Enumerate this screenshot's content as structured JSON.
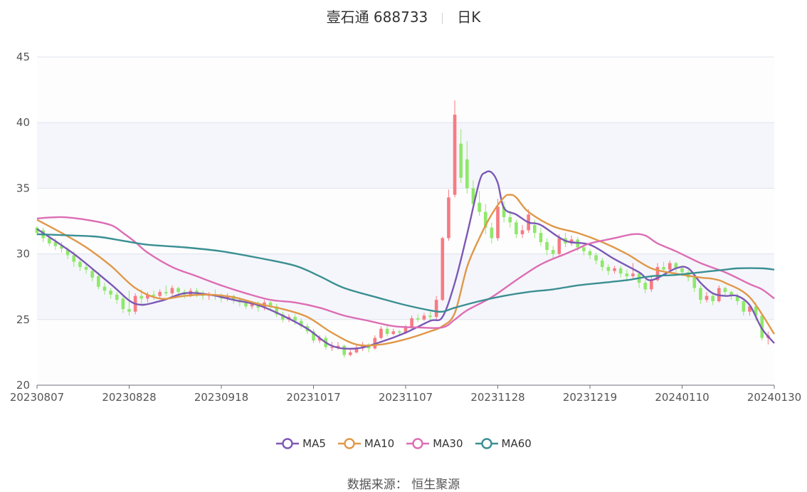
{
  "header": {
    "stock": "壹石通 688733",
    "period": "日K"
  },
  "source": "数据来源：  恒生聚源",
  "colors": {
    "up": "#f77b82",
    "down": "#8ee86a",
    "MA5": "#7c58b5",
    "MA10": "#e09848",
    "MA30": "#dd6db4",
    "MA60": "#3a8f92",
    "grid": "#dfe3ee",
    "band": "#f5f6fb"
  },
  "chart_data": {
    "type": "candlestick",
    "ylim": [
      20,
      45
    ],
    "yticks": [
      "20",
      "25",
      "30",
      "35",
      "40",
      "45"
    ],
    "xticks": [
      "20230807",
      "20230828",
      "20230918",
      "20231017",
      "20231107",
      "20231128",
      "20231219",
      "20240110",
      "20240130"
    ],
    "tick_index": [
      0,
      15,
      30,
      45,
      60,
      75,
      90,
      105,
      120
    ],
    "n_points": 121,
    "candles": [
      [
        32.0,
        31.6,
        32.1,
        31.4
      ],
      [
        31.8,
        31.2,
        32.0,
        30.9
      ],
      [
        31.2,
        30.8,
        31.4,
        30.6
      ],
      [
        30.9,
        30.6,
        31.2,
        30.3
      ],
      [
        30.6,
        30.4,
        30.9,
        30.1
      ],
      [
        30.3,
        29.9,
        30.5,
        29.6
      ],
      [
        29.9,
        29.4,
        30.2,
        29.0
      ],
      [
        29.4,
        29.0,
        29.7,
        28.7
      ],
      [
        29.0,
        28.8,
        29.3,
        28.5
      ],
      [
        28.7,
        28.2,
        28.9,
        27.9
      ],
      [
        28.3,
        27.5,
        28.6,
        27.3
      ],
      [
        27.5,
        27.2,
        27.8,
        26.9
      ],
      [
        27.2,
        26.9,
        27.4,
        26.6
      ],
      [
        26.9,
        26.5,
        27.1,
        26.2
      ],
      [
        26.6,
        25.8,
        26.9,
        25.5
      ],
      [
        25.8,
        25.6,
        27.2,
        25.3
      ],
      [
        25.6,
        26.8,
        27.0,
        25.4
      ],
      [
        26.8,
        26.6,
        27.3,
        26.2
      ],
      [
        26.6,
        26.9,
        27.1,
        26.3
      ],
      [
        26.9,
        26.8,
        27.2,
        26.5
      ],
      [
        26.8,
        27.1,
        27.3,
        26.6
      ],
      [
        27.1,
        27.0,
        27.6,
        26.8
      ],
      [
        27.0,
        27.4,
        27.6,
        26.8
      ],
      [
        27.4,
        27.1,
        27.5,
        26.8
      ],
      [
        27.1,
        26.9,
        27.3,
        26.6
      ],
      [
        26.9,
        27.2,
        27.4,
        26.7
      ],
      [
        27.2,
        27.0,
        27.4,
        26.7
      ],
      [
        27.0,
        26.8,
        27.2,
        26.5
      ],
      [
        26.8,
        26.9,
        27.1,
        26.5
      ],
      [
        26.9,
        26.8,
        27.3,
        26.5
      ],
      [
        26.8,
        26.6,
        27.0,
        26.3
      ],
      [
        26.6,
        26.8,
        27.0,
        26.4
      ],
      [
        26.8,
        26.5,
        26.9,
        26.2
      ],
      [
        26.5,
        26.3,
        26.7,
        26.0
      ],
      [
        26.3,
        26.0,
        26.5,
        25.8
      ],
      [
        26.0,
        26.2,
        26.4,
        25.8
      ],
      [
        26.2,
        25.9,
        26.4,
        25.6
      ],
      [
        25.9,
        26.3,
        26.5,
        25.7
      ],
      [
        26.3,
        26.0,
        26.4,
        25.7
      ],
      [
        26.0,
        25.4,
        26.2,
        25.2
      ],
      [
        25.4,
        25.0,
        25.6,
        24.8
      ],
      [
        25.0,
        25.2,
        25.4,
        24.8
      ],
      [
        25.2,
        24.9,
        25.4,
        24.6
      ],
      [
        24.9,
        24.5,
        25.1,
        24.3
      ],
      [
        24.5,
        24.1,
        24.7,
        23.9
      ],
      [
        24.1,
        23.4,
        24.3,
        23.2
      ],
      [
        23.4,
        23.6,
        23.8,
        23.2
      ],
      [
        23.6,
        22.9,
        23.8,
        22.7
      ],
      [
        22.9,
        22.9,
        23.3,
        22.6
      ],
      [
        22.9,
        23.0,
        23.3,
        22.7
      ],
      [
        23.0,
        22.3,
        23.1,
        22.1
      ],
      [
        22.3,
        22.5,
        22.8,
        22.2
      ],
      [
        22.5,
        22.8,
        23.1,
        22.4
      ],
      [
        22.8,
        23.1,
        23.3,
        22.6
      ],
      [
        23.1,
        22.8,
        23.2,
        22.5
      ],
      [
        22.8,
        23.6,
        23.8,
        22.7
      ],
      [
        23.6,
        24.3,
        24.5,
        23.5
      ],
      [
        24.3,
        23.9,
        24.5,
        23.7
      ],
      [
        23.9,
        24.1,
        24.3,
        23.8
      ],
      [
        24.1,
        24.0,
        24.2,
        23.8
      ],
      [
        24.0,
        24.4,
        24.6,
        23.9
      ],
      [
        24.4,
        25.1,
        25.3,
        24.2
      ],
      [
        25.1,
        25.0,
        25.4,
        24.8
      ],
      [
        25.0,
        25.3,
        25.5,
        24.9
      ],
      [
        25.3,
        25.2,
        25.6,
        24.9
      ],
      [
        25.2,
        26.5,
        26.8,
        25.0
      ],
      [
        26.5,
        31.2,
        31.3,
        26.4
      ],
      [
        31.2,
        34.3,
        34.9,
        31.0
      ],
      [
        34.5,
        40.6,
        41.7,
        34.3
      ],
      [
        38.4,
        35.8,
        39.5,
        35.4
      ],
      [
        37.2,
        35.0,
        38.6,
        34.6
      ],
      [
        35.0,
        33.8,
        35.6,
        33.4
      ],
      [
        33.9,
        33.2,
        34.8,
        32.9
      ],
      [
        33.2,
        32.0,
        33.8,
        31.5
      ],
      [
        32.0,
        31.2,
        32.4,
        30.8
      ],
      [
        31.2,
        33.6,
        34.2,
        31.0
      ],
      [
        33.6,
        32.8,
        34.0,
        32.4
      ],
      [
        32.8,
        32.4,
        33.3,
        32.0
      ],
      [
        32.4,
        31.5,
        32.6,
        31.2
      ],
      [
        31.5,
        31.8,
        32.2,
        31.2
      ],
      [
        31.8,
        33.0,
        33.4,
        31.6
      ],
      [
        32.2,
        31.6,
        32.6,
        31.2
      ],
      [
        31.6,
        30.9,
        32.0,
        30.6
      ],
      [
        30.9,
        30.3,
        31.2,
        29.9
      ],
      [
        30.3,
        30.0,
        30.6,
        29.6
      ],
      [
        30.0,
        31.2,
        31.5,
        29.9
      ],
      [
        31.2,
        30.8,
        31.6,
        30.5
      ],
      [
        30.8,
        31.1,
        31.4,
        30.6
      ],
      [
        31.1,
        30.5,
        31.3,
        30.2
      ],
      [
        30.5,
        30.2,
        30.8,
        29.9
      ],
      [
        30.2,
        29.9,
        30.4,
        29.6
      ],
      [
        29.9,
        29.5,
        30.1,
        29.2
      ],
      [
        29.5,
        29.0,
        29.7,
        28.7
      ],
      [
        29.0,
        28.7,
        29.2,
        28.4
      ],
      [
        28.7,
        28.9,
        29.1,
        28.5
      ],
      [
        28.9,
        28.5,
        29.1,
        28.2
      ],
      [
        28.5,
        28.3,
        28.8,
        27.9
      ],
      [
        28.3,
        28.5,
        29.3,
        28.1
      ],
      [
        28.5,
        27.8,
        28.7,
        27.4
      ],
      [
        27.8,
        27.3,
        28.0,
        27.0
      ],
      [
        27.3,
        28.0,
        28.3,
        27.1
      ],
      [
        28.0,
        29.0,
        29.3,
        27.9
      ],
      [
        29.0,
        28.8,
        29.4,
        28.6
      ],
      [
        28.8,
        29.3,
        29.5,
        28.7
      ],
      [
        29.3,
        28.9,
        29.4,
        28.6
      ],
      [
        28.9,
        28.6,
        29.1,
        28.3
      ],
      [
        28.6,
        28.2,
        28.8,
        27.9
      ],
      [
        28.2,
        27.4,
        28.4,
        27.1
      ],
      [
        27.4,
        26.5,
        27.6,
        26.2
      ],
      [
        26.5,
        26.8,
        27.1,
        26.3
      ],
      [
        26.8,
        26.4,
        27.0,
        26.1
      ],
      [
        26.4,
        27.4,
        27.6,
        26.3
      ],
      [
        27.4,
        27.1,
        27.5,
        26.8
      ],
      [
        27.1,
        26.8,
        27.2,
        26.5
      ],
      [
        26.8,
        26.4,
        27.0,
        26.1
      ],
      [
        26.4,
        25.6,
        26.6,
        25.3
      ],
      [
        25.6,
        26.0,
        26.2,
        25.3
      ],
      [
        26.0,
        25.3,
        26.3,
        24.9
      ],
      [
        25.3,
        23.6,
        25.4,
        23.4
      ],
      [
        23.6,
        23.8,
        24.1,
        23.1
      ]
    ],
    "series": [
      {
        "name": "MA5",
        "color": "#7c58b5",
        "points": [
          [
            0,
            31.9
          ],
          [
            6,
            30.0
          ],
          [
            12,
            27.7
          ],
          [
            16,
            26.2
          ],
          [
            20,
            26.4
          ],
          [
            24,
            27.0
          ],
          [
            28,
            26.9
          ],
          [
            32,
            26.5
          ],
          [
            36,
            26.1
          ],
          [
            40,
            25.3
          ],
          [
            44,
            24.3
          ],
          [
            48,
            23.0
          ],
          [
            52,
            22.8
          ],
          [
            56,
            23.3
          ],
          [
            60,
            24.0
          ],
          [
            64,
            24.9
          ],
          [
            66,
            25.2
          ],
          [
            68,
            27.8
          ],
          [
            70,
            31.5
          ],
          [
            72,
            35.5
          ],
          [
            73,
            36.2
          ],
          [
            74,
            36.2
          ],
          [
            75,
            35.4
          ],
          [
            76,
            33.5
          ],
          [
            78,
            33.0
          ],
          [
            80,
            32.4
          ],
          [
            82,
            32.2
          ],
          [
            86,
            31.0
          ],
          [
            90,
            30.7
          ],
          [
            94,
            29.6
          ],
          [
            98,
            28.6
          ],
          [
            100,
            28.0
          ],
          [
            104,
            28.9
          ],
          [
            106,
            28.9
          ],
          [
            108,
            27.8
          ],
          [
            110,
            27.0
          ],
          [
            112,
            26.8
          ],
          [
            114,
            26.8
          ],
          [
            116,
            26.1
          ],
          [
            118,
            24.3
          ],
          [
            120,
            23.2
          ]
        ]
      },
      {
        "name": "MA10",
        "color": "#e09848",
        "points": [
          [
            0,
            32.6
          ],
          [
            4,
            31.6
          ],
          [
            8,
            30.5
          ],
          [
            12,
            29.1
          ],
          [
            16,
            27.4
          ],
          [
            20,
            26.6
          ],
          [
            24,
            26.8
          ],
          [
            28,
            26.9
          ],
          [
            32,
            26.7
          ],
          [
            36,
            26.2
          ],
          [
            40,
            25.8
          ],
          [
            44,
            25.2
          ],
          [
            48,
            24.0
          ],
          [
            52,
            23.1
          ],
          [
            56,
            23.1
          ],
          [
            60,
            23.5
          ],
          [
            64,
            24.1
          ],
          [
            66,
            24.5
          ],
          [
            68,
            25.5
          ],
          [
            70,
            29.0
          ],
          [
            72,
            31.2
          ],
          [
            74,
            33.0
          ],
          [
            76,
            34.3
          ],
          [
            77,
            34.5
          ],
          [
            78,
            34.3
          ],
          [
            80,
            33.2
          ],
          [
            84,
            32.1
          ],
          [
            88,
            31.6
          ],
          [
            92,
            30.9
          ],
          [
            96,
            30.0
          ],
          [
            100,
            28.9
          ],
          [
            104,
            28.5
          ],
          [
            108,
            28.2
          ],
          [
            110,
            28.1
          ],
          [
            112,
            27.8
          ],
          [
            116,
            26.7
          ],
          [
            120,
            23.9
          ]
        ]
      },
      {
        "name": "MA30",
        "color": "#dd6db4",
        "points": [
          [
            0,
            32.7
          ],
          [
            4,
            32.8
          ],
          [
            8,
            32.6
          ],
          [
            12,
            32.2
          ],
          [
            14,
            31.6
          ],
          [
            16,
            30.9
          ],
          [
            18,
            30.1
          ],
          [
            22,
            29.0
          ],
          [
            26,
            28.3
          ],
          [
            30,
            27.6
          ],
          [
            34,
            27.0
          ],
          [
            38,
            26.5
          ],
          [
            42,
            26.3
          ],
          [
            46,
            25.9
          ],
          [
            50,
            25.3
          ],
          [
            54,
            24.9
          ],
          [
            58,
            24.5
          ],
          [
            62,
            24.4
          ],
          [
            66,
            24.4
          ],
          [
            68,
            25.0
          ],
          [
            70,
            25.7
          ],
          [
            74,
            26.7
          ],
          [
            78,
            28.0
          ],
          [
            82,
            29.2
          ],
          [
            86,
            30.0
          ],
          [
            88,
            30.4
          ],
          [
            90,
            30.8
          ],
          [
            94,
            31.2
          ],
          [
            97,
            31.5
          ],
          [
            99,
            31.4
          ],
          [
            101,
            30.8
          ],
          [
            104,
            30.2
          ],
          [
            108,
            29.3
          ],
          [
            112,
            28.6
          ],
          [
            116,
            27.7
          ],
          [
            118,
            27.3
          ],
          [
            120,
            26.6
          ]
        ]
      },
      {
        "name": "MA60",
        "color": "#3a8f92",
        "points": [
          [
            0,
            31.5
          ],
          [
            6,
            31.4
          ],
          [
            10,
            31.3
          ],
          [
            14,
            31.0
          ],
          [
            18,
            30.7
          ],
          [
            24,
            30.5
          ],
          [
            30,
            30.2
          ],
          [
            36,
            29.7
          ],
          [
            42,
            29.1
          ],
          [
            46,
            28.3
          ],
          [
            50,
            27.4
          ],
          [
            56,
            26.6
          ],
          [
            60,
            26.1
          ],
          [
            64,
            25.7
          ],
          [
            66,
            25.6
          ],
          [
            68,
            25.9
          ],
          [
            72,
            26.4
          ],
          [
            76,
            26.8
          ],
          [
            80,
            27.1
          ],
          [
            84,
            27.3
          ],
          [
            88,
            27.6
          ],
          [
            92,
            27.8
          ],
          [
            96,
            28.0
          ],
          [
            100,
            28.3
          ],
          [
            104,
            28.4
          ],
          [
            108,
            28.6
          ],
          [
            112,
            28.8
          ],
          [
            114,
            28.9
          ],
          [
            118,
            28.9
          ],
          [
            120,
            28.8
          ]
        ]
      }
    ]
  }
}
